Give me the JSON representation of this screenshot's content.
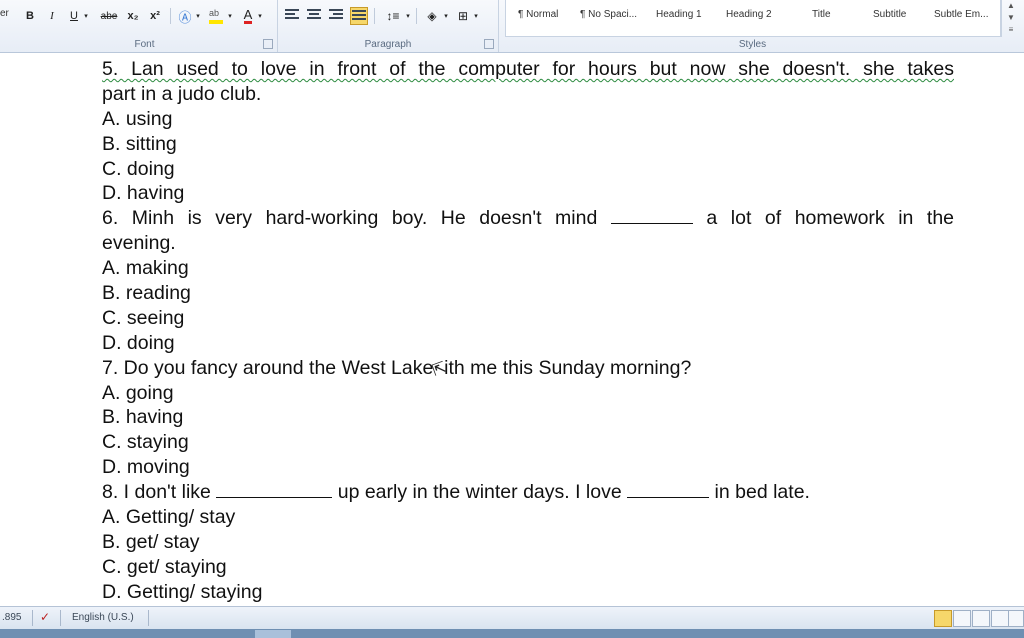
{
  "ribbon": {
    "edge_label": "er",
    "font_group": {
      "label": "Font",
      "buttons": [
        "B",
        "I",
        "U",
        "abe",
        "x₂",
        "x²",
        "A"
      ]
    },
    "paragraph_group": {
      "label": "Paragraph"
    },
    "styles_group": {
      "label": "Styles",
      "items": [
        "¶ Normal",
        "¶ No Spaci...",
        "Heading 1",
        "Heading 2",
        "Title",
        "Subtitle",
        "Subtle Em..."
      ]
    }
  },
  "document": {
    "lines": [
      {
        "text": "5. Lan used to love in front of the computer for hours but now she doesn't. she takes",
        "justify": true
      },
      {
        "text": "part in a judo club."
      },
      {
        "text": "A. using"
      },
      {
        "text": "B. sitting"
      },
      {
        "text": "C. doing"
      },
      {
        "text": "D. having"
      },
      {
        "pre": "6. Minh is very hard-working boy. He doesn't mind",
        "post": "a lot of homework in the",
        "justify": true
      },
      {
        "text": "evening."
      },
      {
        "text": "A. making"
      },
      {
        "text": "B. reading"
      },
      {
        "text": "C. seeing"
      },
      {
        "text": "D. doing"
      },
      {
        "pre": "7. Do you fancy around the West Lake ",
        "post": "ith me this Sunday morning?",
        "cursor": true
      },
      {
        "text": "A. going"
      },
      {
        "text": "B. having"
      },
      {
        "text": "C. staying"
      },
      {
        "text": "D. moving"
      },
      {
        "pre": "8. I don't like",
        "mid": "up early in the winter days. I love",
        "post": "in bed late."
      },
      {
        "text": "A. Getting/ stay"
      },
      {
        "text": "B. get/ stay"
      },
      {
        "text": "C. get/ staying"
      },
      {
        "text": "D. Getting/ staying"
      }
    ]
  },
  "status_bar": {
    "word_count": ".895",
    "language": "English (U.S.)"
  },
  "colors": {
    "ribbon_bg": "#e7edf6",
    "active_highlight": "#f6d76a",
    "spell_squiggle": "#2b8a3e"
  }
}
